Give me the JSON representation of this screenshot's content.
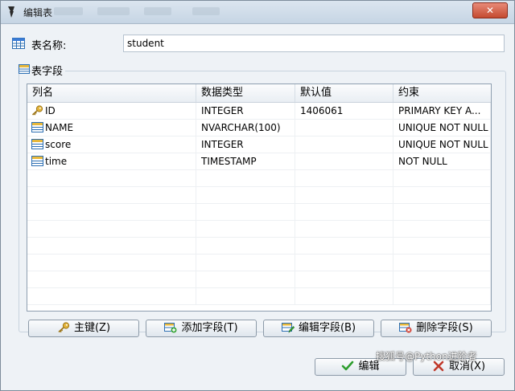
{
  "window": {
    "title": "编辑表"
  },
  "form": {
    "table_name_label": "表名称:",
    "table_name_value": "student",
    "fields_section_label": "表字段"
  },
  "grid": {
    "columns": [
      "列名",
      "数据类型",
      "默认值",
      "约束"
    ],
    "rows": [
      {
        "name": "ID",
        "type": "INTEGER",
        "default": "1406061",
        "constraint": "PRIMARY KEY A...",
        "icon": "key-icon"
      },
      {
        "name": "NAME",
        "type": "NVARCHAR(100)",
        "default": "",
        "constraint": "UNIQUE NOT NULL",
        "icon": "field-icon"
      },
      {
        "name": "score",
        "type": "INTEGER",
        "default": "",
        "constraint": "UNIQUE NOT NULL",
        "icon": "field-icon"
      },
      {
        "name": "time",
        "type": "TIMESTAMP",
        "default": "",
        "constraint": "NOT NULL",
        "icon": "field-icon"
      }
    ]
  },
  "buttons": {
    "primary_key": "主键(Z)",
    "add_field": "添加字段(T)",
    "edit_field": "编辑字段(B)",
    "delete_field": "删除字段(S)",
    "ok": "编辑",
    "cancel": "取消(X)"
  },
  "watermark": "搜狐号@Python进阶者",
  "colors": {
    "accent": "#3a7bd5",
    "ok_check": "#2e9e2e",
    "cancel_x": "#c0392b"
  }
}
